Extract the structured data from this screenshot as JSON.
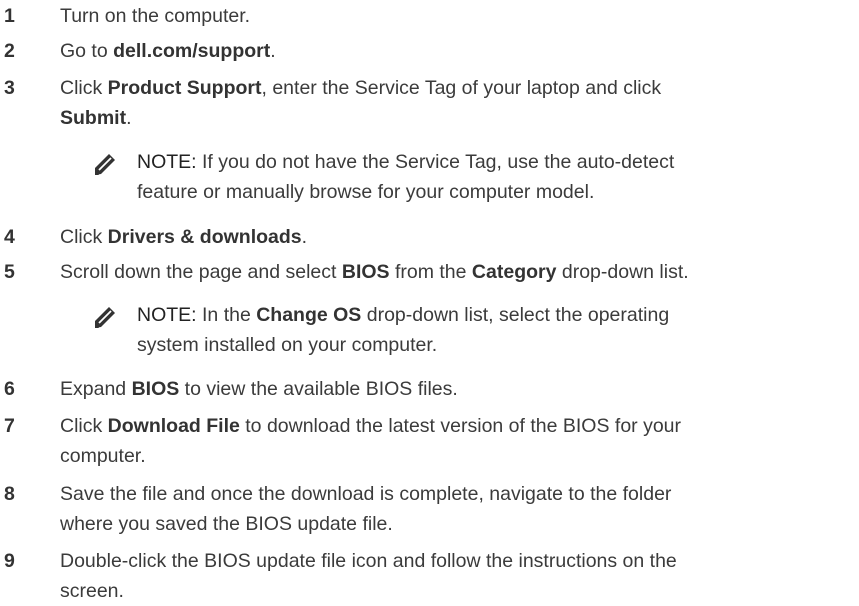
{
  "steps": [
    {
      "number": "1",
      "parts": [
        "Turn on the computer."
      ]
    },
    {
      "number": "2",
      "parts": [
        "Go to ",
        "dell.com/support",
        "."
      ]
    },
    {
      "number": "3",
      "parts": [
        "Click ",
        "Product Support",
        ", enter the Service Tag of your laptop and click",
        "Submit",
        "."
      ]
    },
    {
      "number": "4",
      "parts": [
        "Click ",
        "Drivers & downloads",
        "."
      ]
    },
    {
      "number": "5",
      "parts": [
        "Scroll down the page and select ",
        "BIOS",
        " from the ",
        "Category",
        " drop-down list."
      ]
    },
    {
      "number": "6",
      "parts": [
        "Expand ",
        "BIOS",
        " to view the available BIOS files."
      ]
    },
    {
      "number": "7",
      "parts": [
        "Click ",
        "Download File",
        " to download the latest version of the BIOS for your",
        "computer."
      ]
    },
    {
      "number": "8",
      "parts": [
        "Save the file and once the download is complete, navigate to the folder",
        "where you saved the BIOS update file."
      ]
    },
    {
      "number": "9",
      "parts": [
        "Double-click the BIOS update file icon and follow the instructions on the",
        "screen."
      ]
    }
  ],
  "notes": [
    {
      "label": "NOTE:",
      "lines": [
        " If you do not have the Service Tag, use the auto-detect",
        "feature or manually browse for your computer model."
      ]
    },
    {
      "label": "NOTE:",
      "lines": [
        " In the ",
        "Change OS",
        " drop-down list, select the operating",
        "system installed on your computer."
      ]
    }
  ],
  "icon": "note-pencil-icon"
}
